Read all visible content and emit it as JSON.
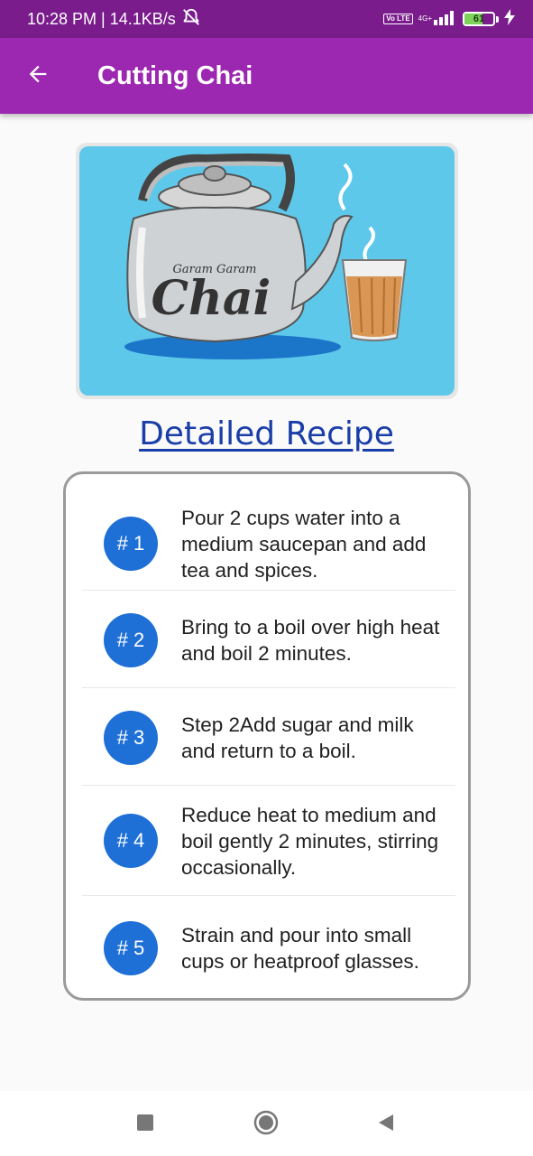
{
  "status_bar": {
    "time_speed": "10:28 PM | 14.1KB/s",
    "network_label": "4G+",
    "volte_label": "Vo LTE",
    "battery_level": "61",
    "battery_fraction": 0.61
  },
  "app_bar": {
    "title": "Cutting Chai",
    "back_icon": "arrow-back-icon"
  },
  "hero_image": {
    "logo_script": "Garam Garam",
    "logo_word": "Chai"
  },
  "recipe_link": "Detailed Recipe",
  "steps": [
    {
      "badge": "# 1",
      "text": "Pour 2 cups water into a medium saucepan and add tea and spices."
    },
    {
      "badge": "# 2",
      "text": "Bring to a boil over high heat and boil 2 minutes."
    },
    {
      "badge": "# 3",
      "text": "Step 2Add sugar and milk and return to a boil."
    },
    {
      "badge": "# 4",
      "text": "Reduce heat to medium and boil gently 2 minutes, stirring occasionally."
    },
    {
      "badge": "# 5",
      "text": "Strain and pour into small cups or heatproof glasses."
    }
  ],
  "nav": {
    "recents_icon": "square-recents-icon",
    "home_icon": "circle-home-icon",
    "back_icon": "triangle-back-icon"
  },
  "colors": {
    "status_bar": "#7a1c8c",
    "app_bar": "#9c27b0",
    "badge": "#1e6fd6",
    "link": "#1a3ea8",
    "hero_bg": "#5ec8ea"
  }
}
